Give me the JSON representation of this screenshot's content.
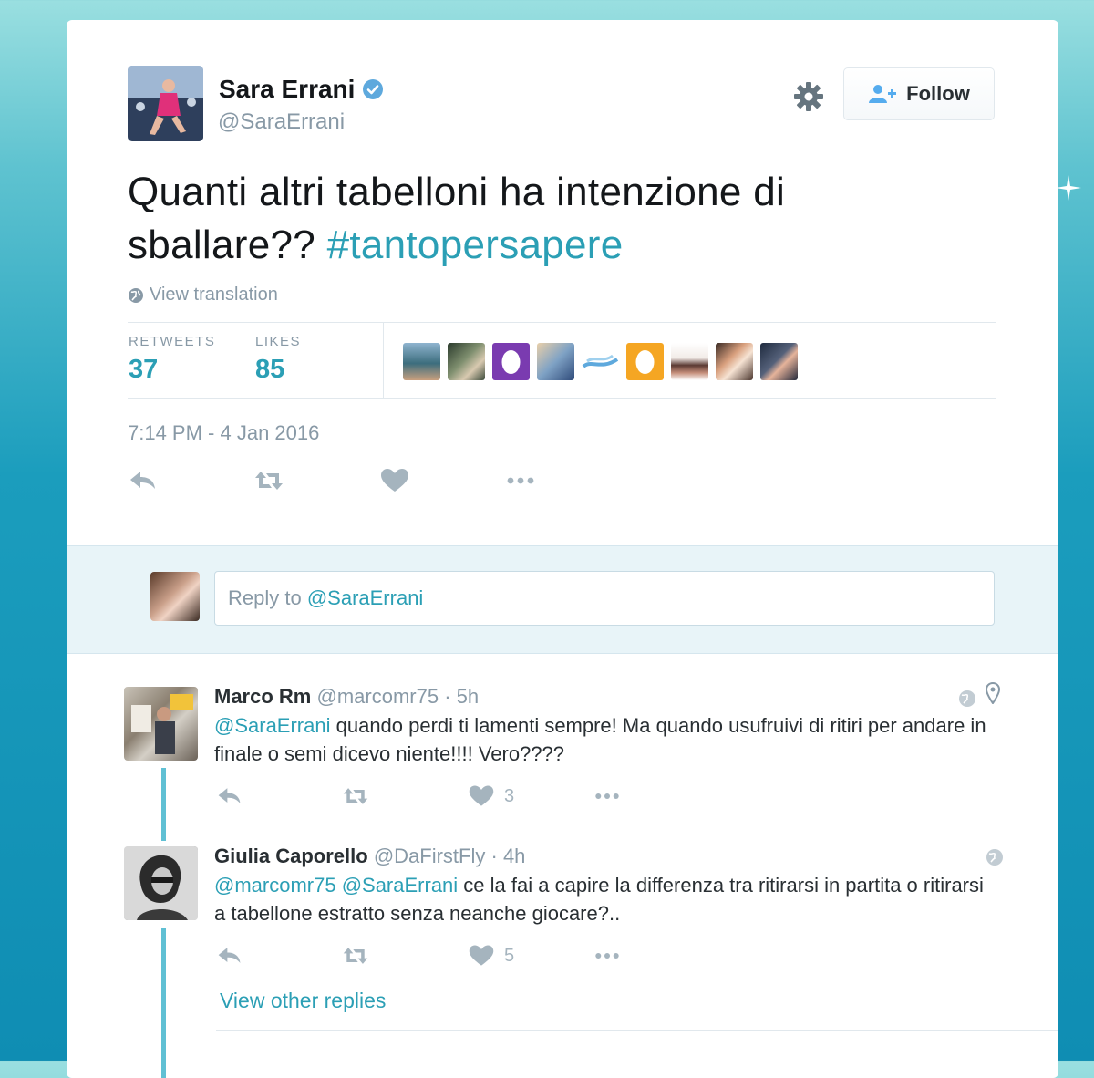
{
  "tweet": {
    "author": {
      "name": "Sara Errani",
      "handle": "@SaraErrani",
      "verified_icon": "verified-badge-icon"
    },
    "follow_label": "Follow",
    "text_plain": "Quanti altri tabelloni ha intenzione di sballare??",
    "hashtag": "#tantopersapere",
    "view_translation": "View translation",
    "stats": {
      "retweets_label": "RETWEETS",
      "retweets_value": "37",
      "likes_label": "LIKES",
      "likes_value": "85"
    },
    "timestamp": "7:14 PM - 4 Jan 2016"
  },
  "reply_box": {
    "prefix": "Reply to ",
    "mention": "@SaraErrani"
  },
  "replies": [
    {
      "name": "Marco Rm",
      "handle": "@marcomr75",
      "time": "· 5h",
      "mentions": "@SaraErrani",
      "text": " quando perdi ti lamenti sempre! Ma quando usufruivi di ritiri per andare in finale o semi dicevo niente!!!! Vero????",
      "like_count": "3"
    },
    {
      "name": "Giulia Caporello",
      "handle": "@DaFirstFly",
      "time": "· 4h",
      "mentions": "@marcomr75 @SaraErrani",
      "text": " ce la fai a capire la differenza tra ritirarsi in partita o ritirarsi a tabellone estratto senza neanche giocare?..",
      "like_count": "5"
    }
  ],
  "view_other_replies": "View other replies",
  "colors": {
    "accent": "#2b9fb5",
    "muted": "#8899a6",
    "text": "#14171a",
    "thread_line": "#60c0d4"
  }
}
